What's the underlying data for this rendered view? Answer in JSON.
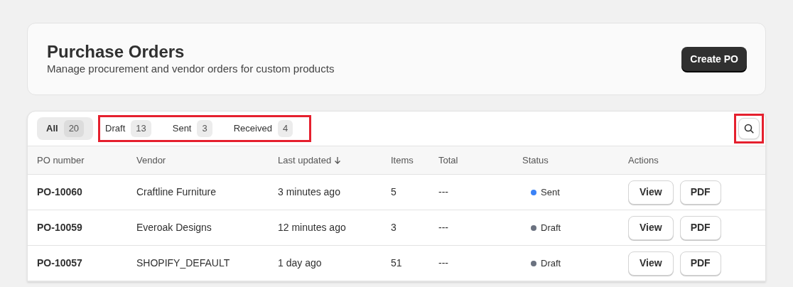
{
  "header": {
    "title": "Purchase Orders",
    "subtitle": "Manage procurement and vendor orders for custom products",
    "create_button": "Create PO"
  },
  "tabs": [
    {
      "label": "All",
      "count": "20",
      "selected": true
    },
    {
      "label": "Draft",
      "count": "13",
      "selected": false,
      "highlighted": true
    },
    {
      "label": "Sent",
      "count": "3",
      "selected": false,
      "highlighted": true
    },
    {
      "label": "Received",
      "count": "4",
      "selected": false,
      "highlighted": true
    }
  ],
  "search": {
    "highlighted": true
  },
  "table": {
    "columns": [
      {
        "label": "PO number",
        "sorted": false
      },
      {
        "label": "Vendor",
        "sorted": false
      },
      {
        "label": "Last updated",
        "sorted": true
      },
      {
        "label": "Items",
        "sorted": false
      },
      {
        "label": "Total",
        "sorted": false
      },
      {
        "label": "Status",
        "sorted": false
      },
      {
        "label": "Actions",
        "sorted": false
      }
    ],
    "rows": [
      {
        "po_number": "PO-10060",
        "vendor": "Craftline Furniture",
        "last_updated": "3 minutes ago",
        "items": "5",
        "total": "---",
        "status": "Sent",
        "color": "#3b82f6",
        "actions": [
          "View",
          "PDF"
        ]
      },
      {
        "po_number": "PO-10059",
        "vendor": "Everoak Designs",
        "last_updated": "12 minutes ago",
        "items": "3",
        "total": "---",
        "status": "Draft",
        "color": "#6b7280",
        "actions": [
          "View",
          "PDF"
        ]
      },
      {
        "po_number": "PO-10057",
        "vendor": "SHOPIFY_DEFAULT",
        "last_updated": "1 day ago",
        "items": "51",
        "total": "---",
        "status": "Draft",
        "color": "#6b7280",
        "actions": [
          "View",
          "PDF"
        ]
      }
    ]
  }
}
